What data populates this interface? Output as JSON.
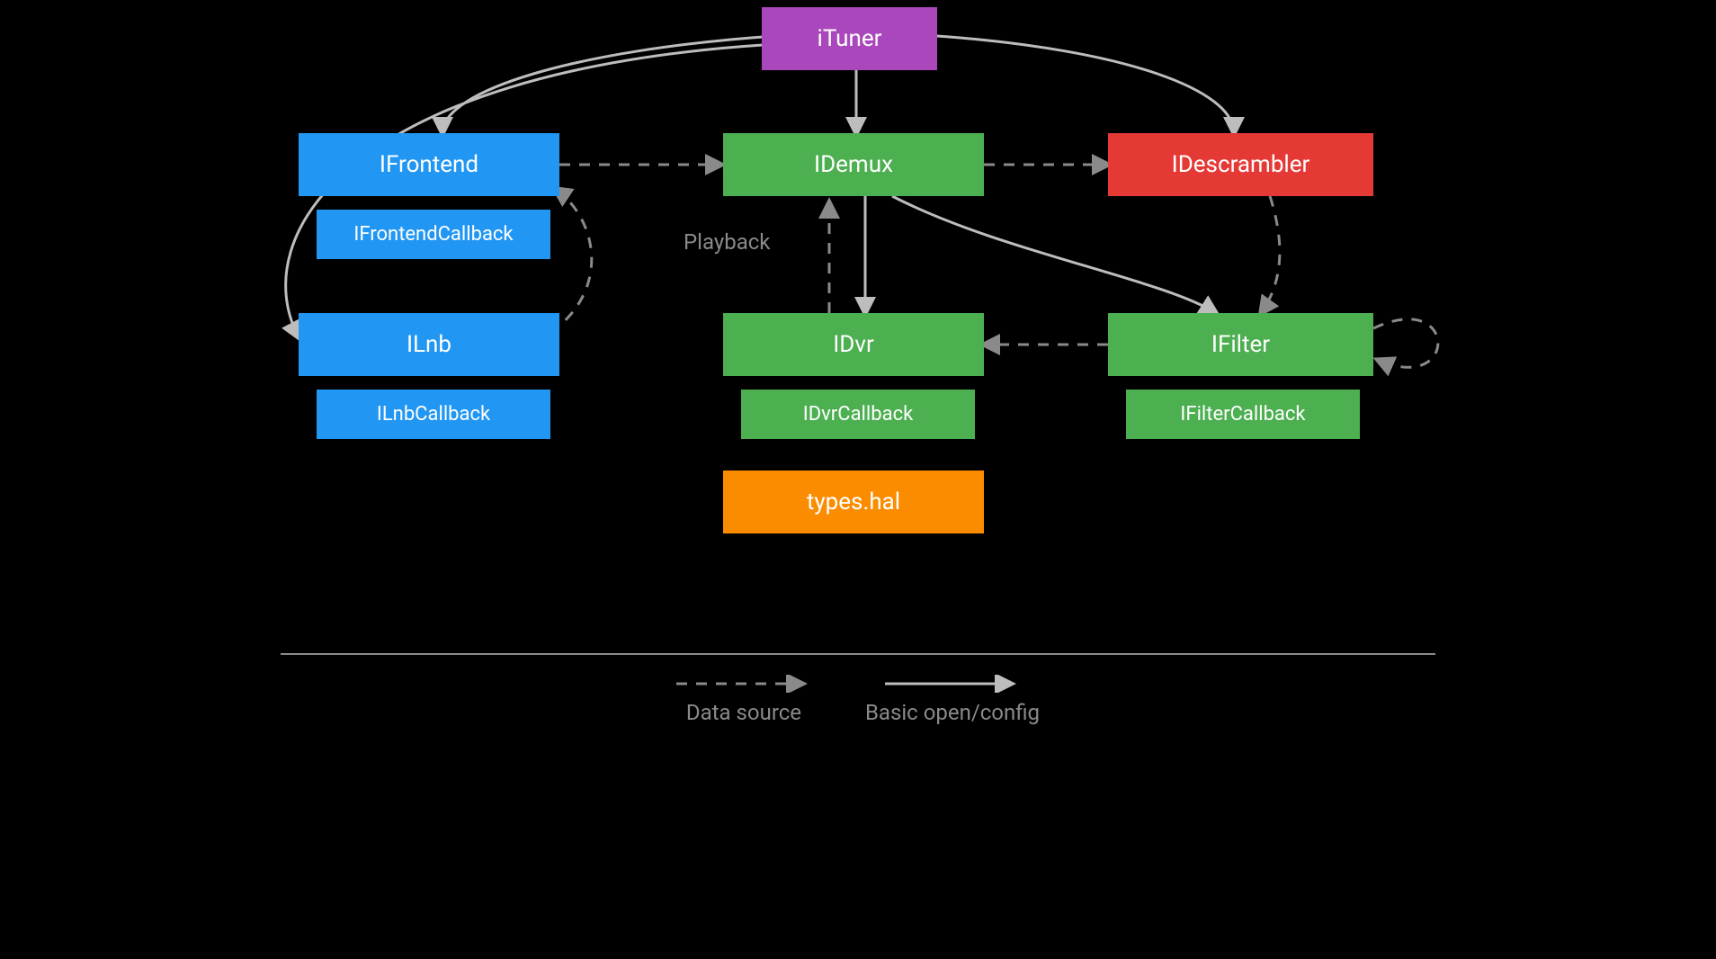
{
  "nodes": {
    "ituner": "iTuner",
    "ifrontend": "IFrontend",
    "ifrontendcb": "IFrontendCallback",
    "ilnb": "ILnb",
    "ilnbcb": "ILnbCallback",
    "idemux": "IDemux",
    "idvr": "IDvr",
    "idvrcb": "IDvrCallback",
    "typeshal": "types.hal",
    "idescr": "IDescrambler",
    "ifilter": "IFilter",
    "ifiltercb": "IFilterCallback"
  },
  "labels": {
    "playback": "Playback"
  },
  "legend": {
    "datasource": "Data source",
    "basic": "Basic open/config"
  },
  "colors": {
    "purple": "#ab47bc",
    "blue": "#2196f3",
    "green": "#4caf50",
    "red": "#e53935",
    "orange": "#fb8c00",
    "line": "#bdbdbd",
    "dash": "#8a8a8a"
  }
}
